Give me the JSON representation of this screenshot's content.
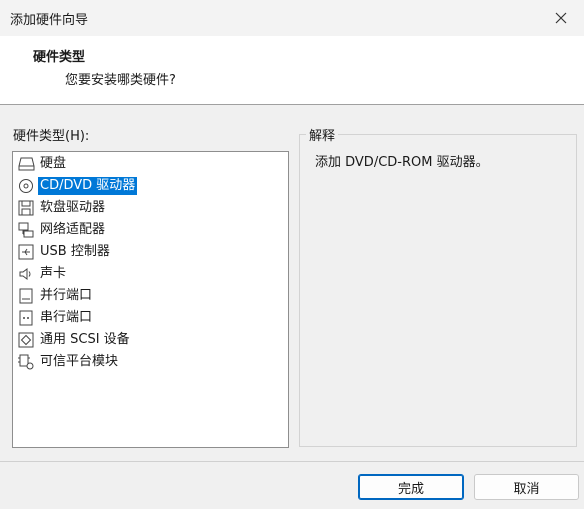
{
  "window": {
    "title": "添加硬件向导"
  },
  "header": {
    "title": "硬件类型",
    "subtitle": "您要安装哪类硬件?"
  },
  "list": {
    "label": "硬件类型(H):",
    "items": [
      {
        "label": "硬盘",
        "icon": "hard-disk-icon"
      },
      {
        "label": "CD/DVD 驱动器",
        "icon": "cd-dvd-icon"
      },
      {
        "label": "软盘驱动器",
        "icon": "floppy-icon"
      },
      {
        "label": "网络适配器",
        "icon": "network-adapter-icon"
      },
      {
        "label": "USB 控制器",
        "icon": "usb-icon"
      },
      {
        "label": "声卡",
        "icon": "speaker-icon"
      },
      {
        "label": "并行端口",
        "icon": "parallel-port-icon"
      },
      {
        "label": "串行端口",
        "icon": "serial-port-icon"
      },
      {
        "label": "通用 SCSI 设备",
        "icon": "scsi-icon"
      },
      {
        "label": "可信平台模块",
        "icon": "tpm-chip-icon"
      }
    ],
    "selected_label": "CD/DVD 驱动器"
  },
  "explanation": {
    "legend": "解释",
    "text": "添加 DVD/CD-ROM 驱动器。"
  },
  "buttons": {
    "finish": "完成",
    "cancel": "取消"
  },
  "colors": {
    "selection": "#0078d7",
    "primary_border": "#0067c0"
  }
}
